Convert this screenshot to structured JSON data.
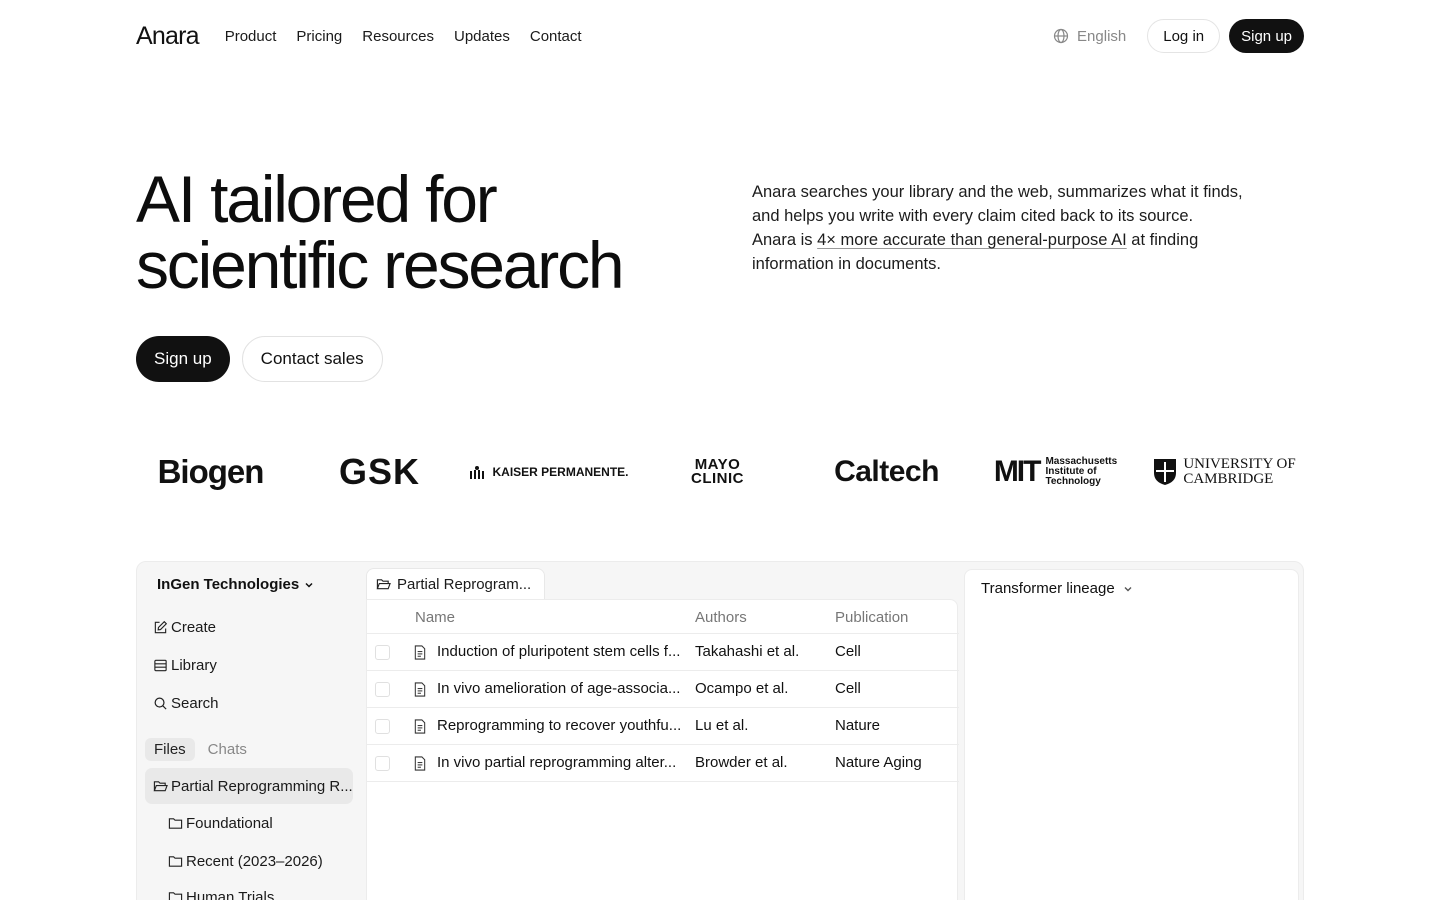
{
  "nav": {
    "logo": "Anara",
    "links": [
      "Product",
      "Pricing",
      "Resources",
      "Updates",
      "Contact"
    ],
    "language": "English",
    "login": "Log in",
    "signup": "Sign up"
  },
  "hero": {
    "title_line1": "AI tailored for",
    "title_line2": "scientific research",
    "desc_part1": "Anara searches your library and the web, summarizes what it finds, and helps you write with every claim cited back to its source.",
    "desc_part2": "Anara is ",
    "desc_link": "4× more accurate than general-purpose AI",
    "desc_part3": " at finding information in documents.",
    "cta_primary": "Sign up",
    "cta_secondary": "Contact sales"
  },
  "logos": {
    "biogen": "Biogen",
    "gsk": "GSK",
    "kaiser": "KAISER PERMANENTE.",
    "mayo_line1": "MAYO",
    "mayo_line2": "CLINIC",
    "caltech": "Caltech",
    "mit_mark": "MIT",
    "mit_line1": "Massachusetts",
    "mit_line2": "Institute of",
    "mit_line3": "Technology",
    "cam_line1": "UNIVERSITY OF",
    "cam_line2": "CAMBRIDGE"
  },
  "app": {
    "workspace": "InGen Technologies",
    "sidebar": {
      "create": "Create",
      "library": "Library",
      "search": "Search",
      "tab_files": "Files",
      "tab_chats": "Chats",
      "active_folder": "Partial Reprogramming R...",
      "subfolders": [
        "Foundational",
        "Recent (2023–2026)",
        "Human Trials"
      ]
    },
    "doc_tab": "Partial Reprogram...",
    "table": {
      "headers": {
        "name": "Name",
        "authors": "Authors",
        "publication": "Publication"
      },
      "rows": [
        {
          "name": "Induction of pluripotent stem cells f...",
          "authors": "Takahashi et al.",
          "publication": "Cell"
        },
        {
          "name": "In vivo amelioration of age-associa...",
          "authors": "Ocampo et al.",
          "publication": "Cell"
        },
        {
          "name": "Reprogramming to recover youthfu...",
          "authors": "Lu et al.",
          "publication": "Nature"
        },
        {
          "name": "In vivo partial reprogramming alter...",
          "authors": "Browder et al.",
          "publication": "Nature Aging"
        }
      ]
    },
    "right_panel_title": "Transformer lineage"
  }
}
